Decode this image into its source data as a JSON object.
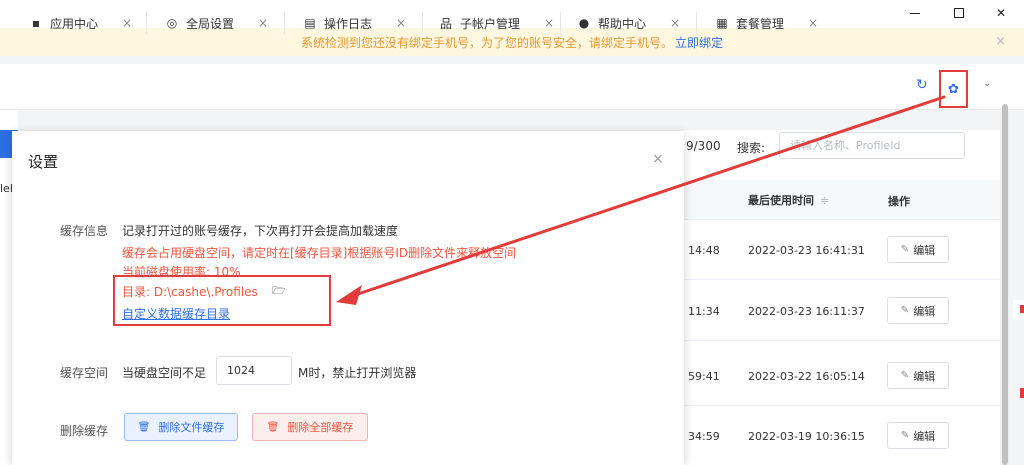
{
  "window": {
    "min": "–",
    "close": "✕"
  },
  "notice": {
    "text": "系统检测到您还没有绑定手机号，为了您的账号安全，请绑定手机号。",
    "link": "立即绑定",
    "close": "×"
  },
  "tabs": [
    {
      "label": "应用中心",
      "icon": "grid-icon",
      "glyph": "▪",
      "close": "×"
    },
    {
      "label": "全局设置",
      "icon": "settings-icon",
      "glyph": "◎",
      "close": "×"
    },
    {
      "label": "操作日志",
      "icon": "log-icon",
      "glyph": "▤",
      "close": "×"
    },
    {
      "label": "子帐户管理",
      "icon": "org-icon",
      "glyph": "品",
      "close": "×"
    },
    {
      "label": "帮助中心",
      "icon": "help-icon",
      "glyph": "●",
      "close": "×"
    },
    {
      "label": "套餐管理",
      "icon": "package-icon",
      "glyph": "▦",
      "close": "×"
    }
  ],
  "toolbar": {
    "refresh": "↻",
    "gear": "✿",
    "chevron": "⌄"
  },
  "background": {
    "left_text": "lel",
    "count": "9/300",
    "search_label": "搜索:",
    "search_placeholder": "请输入名称、ProfileId",
    "headers": {
      "last_used": "最后使用时间",
      "sort": "≑",
      "actions": "操作"
    },
    "rows": [
      {
        "left": "14:48",
        "time": "2022-03-23 16:41:31",
        "edit": "编辑"
      },
      {
        "left": "11:34",
        "time": "2022-03-23 16:11:37",
        "edit": "编辑"
      },
      {
        "left": "59:41",
        "time": "2022-03-22 16:05:14",
        "edit": "编辑"
      },
      {
        "left": "34:59",
        "time": "2022-03-19 10:36:15",
        "edit": "编辑"
      }
    ]
  },
  "modal": {
    "title": "设置",
    "close": "×",
    "cache_info": {
      "label": "缓存信息",
      "desc": "记录打开过的账号缓存，下次再打开会提高加载速度",
      "warning": "缓存会占用硬盘空间，请定时在[缓存目录]根据账号ID删除文件来释放空间",
      "usage": "当前磁盘使用率: 10%",
      "dir": "目录: D:\\cashe\\.Profiles",
      "custom_link": "自定义数据缓存目录"
    },
    "cache_space": {
      "label": "缓存空间",
      "prefix": "当硬盘空间不足",
      "value": "1024",
      "suffix": "M时，禁止打开浏览器"
    },
    "delete_cache": {
      "label": "删除缓存",
      "delete_files": "删除文件缓存",
      "delete_all": "删除全部缓存"
    }
  },
  "colors": {
    "primary": "#2f6fe4",
    "danger": "#f0563f",
    "highlight": "#e23b3b",
    "notice": "#e69a2e"
  }
}
